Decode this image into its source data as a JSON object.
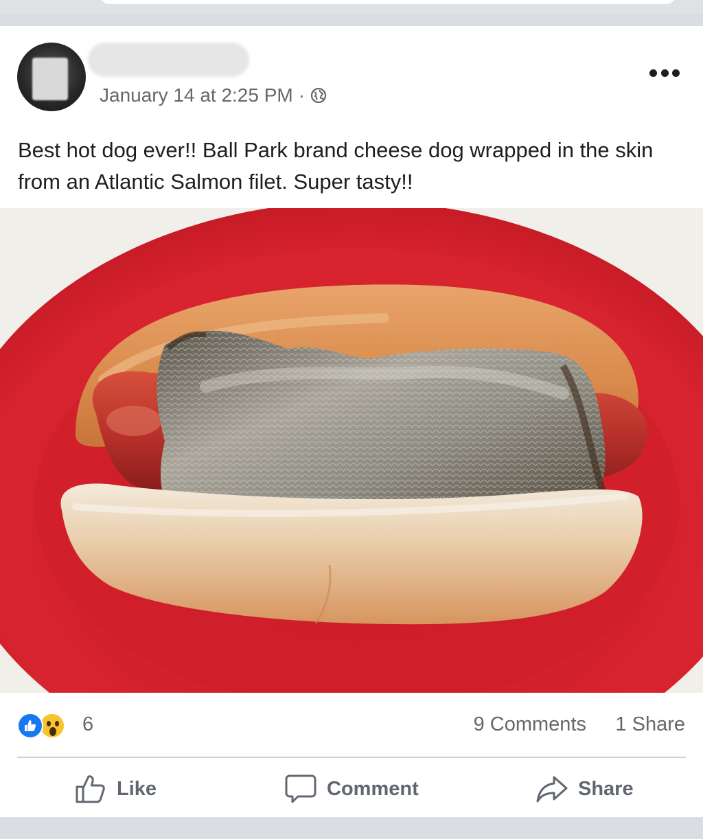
{
  "post": {
    "timestamp": "January 14 at 2:25 PM",
    "separator": "·",
    "privacy_icon": "globe-icon",
    "more_icon": "more-options-icon",
    "text": "Best hot dog ever!! Ball Park brand cheese dog wrapped in the skin from an Atlantic Salmon filet. Super tasty!!",
    "photo_subject": "hot dog wrapped in salmon skin on a red plate"
  },
  "stats": {
    "reaction_count": "6",
    "reaction_icons": [
      "like-reaction-icon",
      "wow-reaction-icon"
    ],
    "comments": "9 Comments",
    "shares": "1 Share"
  },
  "actions": {
    "like_label": "Like",
    "comment_label": "Comment",
    "share_label": "Share"
  },
  "colors": {
    "like_blue": "#1877f2",
    "wow_yellow": "#f7c32e",
    "secondary_text": "#65676b",
    "plate_red": "#d8242e"
  }
}
